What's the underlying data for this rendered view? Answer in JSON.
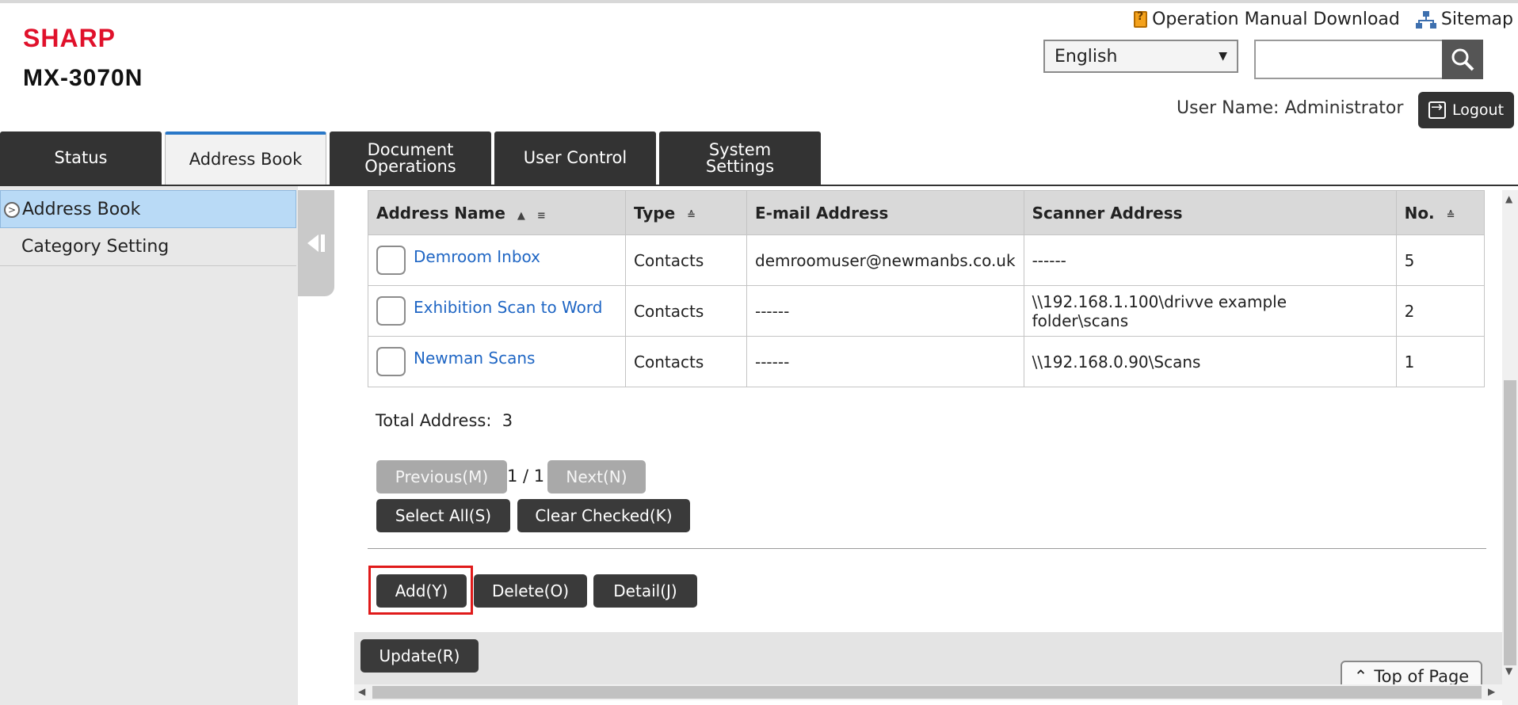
{
  "brand": {
    "logo": "SHARP",
    "model": "MX-3070N"
  },
  "header": {
    "manual_link": "Operation Manual Download",
    "sitemap_link": "Sitemap",
    "language": "English",
    "search_value": "",
    "user_label": "User Name:",
    "user_name": "Administrator",
    "logout": "Logout"
  },
  "tabs": [
    {
      "label": "Status"
    },
    {
      "label": "Address Book"
    },
    {
      "label": "Document Operations"
    },
    {
      "label": "User Control"
    },
    {
      "label": "System Settings"
    }
  ],
  "sidebar": {
    "items": [
      {
        "label": "Address Book"
      },
      {
        "label": "Category Setting"
      }
    ]
  },
  "table": {
    "headers": {
      "name": "Address Name",
      "type": "Type",
      "email": "E-mail Address",
      "scanner": "Scanner Address",
      "no": "No."
    },
    "rows": [
      {
        "name": "Demroom Inbox",
        "type": "Contacts",
        "email": "demroomuser@newmanbs.co.uk",
        "scanner": "------",
        "no": "5"
      },
      {
        "name": "Exhibition Scan to Word",
        "type": "Contacts",
        "email": "------",
        "scanner": "\\\\192.168.1.100\\drivve example folder\\scans",
        "no": "2"
      },
      {
        "name": "Newman Scans",
        "type": "Contacts",
        "email": "------",
        "scanner": "\\\\192.168.0.90\\Scans",
        "no": "1"
      }
    ]
  },
  "summary": {
    "total_label": "Total Address:",
    "total_value": "3"
  },
  "pagination": {
    "prev": "Previous(M)",
    "indicator": "1 / 1",
    "next": "Next(N)"
  },
  "actions": {
    "select_all": "Select All(S)",
    "clear_checked": "Clear Checked(K)",
    "add": "Add(Y)",
    "delete": "Delete(O)",
    "detail": "Detail(J)",
    "update": "Update(R)",
    "top_of_page": "Top of Page"
  },
  "colors": {
    "brand_red": "#e0112b",
    "tab_dark": "#333333",
    "tab_active_accent": "#2a78c8",
    "link_blue": "#1f66c4",
    "highlight_red": "#e01a1a"
  }
}
